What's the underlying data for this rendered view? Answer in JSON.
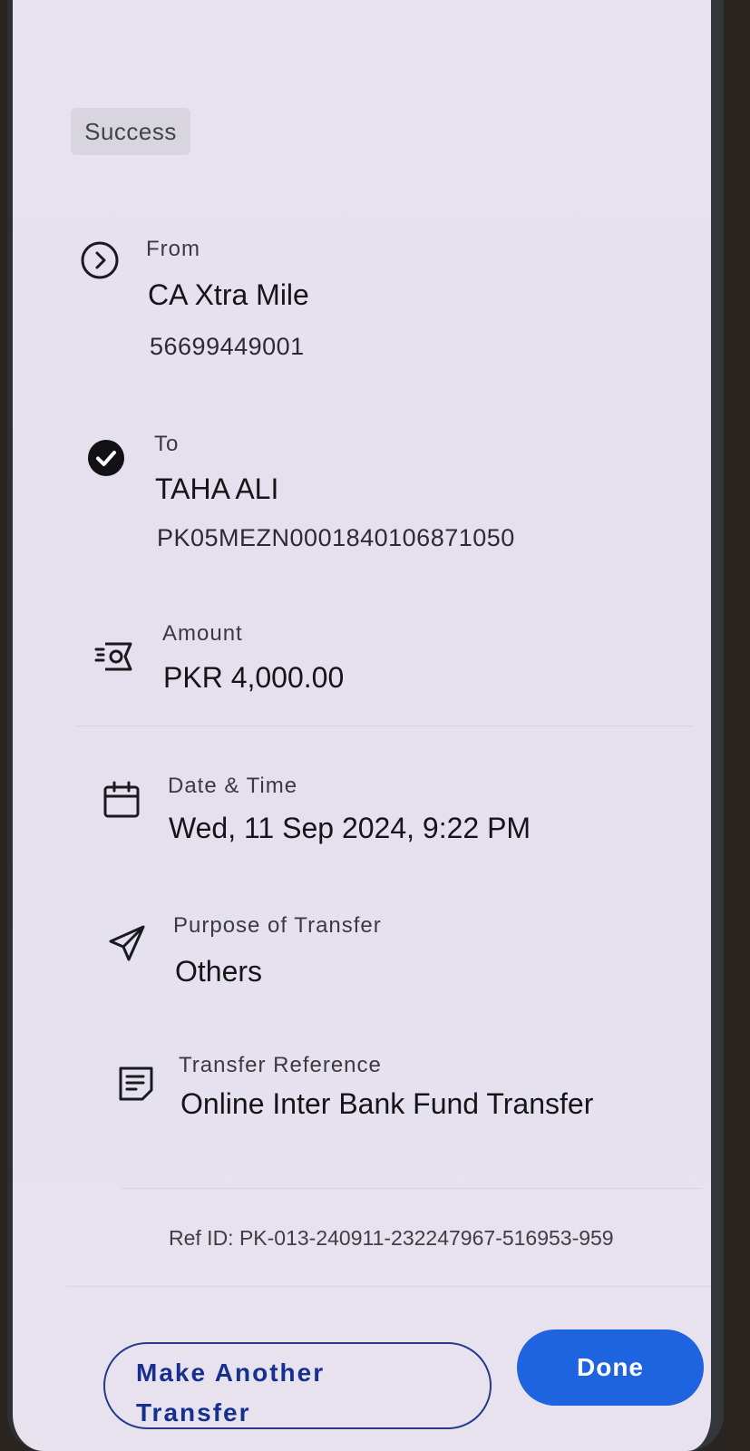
{
  "status": {
    "badge": "Success"
  },
  "from": {
    "label": "From",
    "name": "CA Xtra Mile",
    "account": "56699449001",
    "icon": "chevron-right-circle-icon"
  },
  "to": {
    "label": "To",
    "name": "TAHA ALI",
    "iban": "PK05MEZN0001840106871050",
    "icon": "check-circle-icon"
  },
  "amount": {
    "label": "Amount",
    "value": "PKR 4,000.00",
    "icon": "cash-icon"
  },
  "datetime": {
    "label": "Date & Time",
    "value": "Wed, 11 Sep 2024, 9:22 PM",
    "icon": "calendar-icon"
  },
  "purpose": {
    "label": "Purpose of Transfer",
    "value": "Others",
    "icon": "send-icon"
  },
  "reference": {
    "label": "Transfer Reference",
    "value": "Online Inter Bank Fund Transfer",
    "icon": "document-icon"
  },
  "ref_id": "Ref ID: PK-013-240911-232247967-516953-959",
  "actions": {
    "make_another_line1": "Make Another",
    "make_another_line2": "Transfer",
    "done": "Done"
  },
  "colors": {
    "primary": "#1e63e0",
    "outline_text": "#16308f",
    "background": "#e8e1ef"
  }
}
